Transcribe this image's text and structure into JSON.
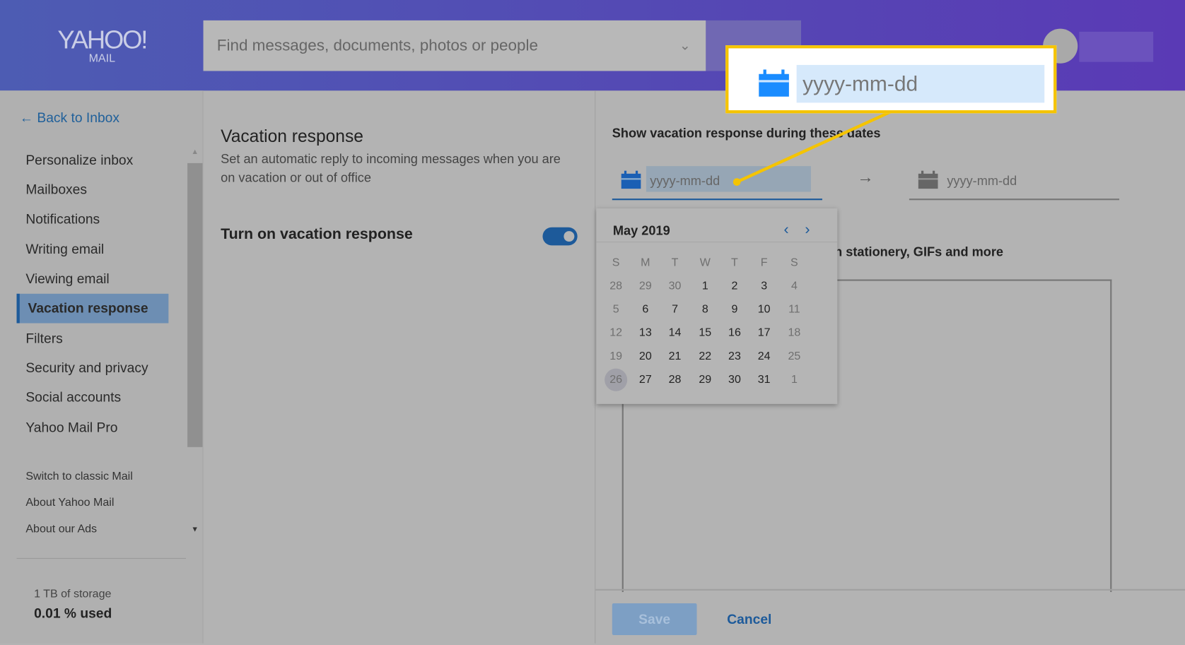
{
  "header": {
    "logo_main": "YAHOO!",
    "logo_sub": "MAIL",
    "search_placeholder": "Find messages, documents, photos or people"
  },
  "sidebar": {
    "back": "Back to Inbox",
    "items": [
      {
        "label": "Personalize inbox"
      },
      {
        "label": "Mailboxes"
      },
      {
        "label": "Notifications"
      },
      {
        "label": "Writing email"
      },
      {
        "label": "Viewing email"
      },
      {
        "label": "Vacation response",
        "selected": true
      },
      {
        "label": "Filters"
      },
      {
        "label": "Security and privacy"
      },
      {
        "label": "Social accounts"
      },
      {
        "label": "Yahoo Mail Pro"
      }
    ],
    "links": [
      {
        "label": "Switch to classic Mail"
      },
      {
        "label": "About Yahoo Mail"
      },
      {
        "label": "About our Ads"
      }
    ],
    "storage_label": "1 TB of storage",
    "storage_used": "0.01 % used"
  },
  "settings": {
    "title": "Vacation response",
    "description": "Set an automatic reply to incoming messages when you are on vacation or out of office",
    "toggle_label": "Turn on vacation response",
    "toggle_on": true
  },
  "dates": {
    "heading": "Show vacation response during these dates",
    "start_placeholder": "yyyy-mm-dd",
    "end_placeholder": "yyyy-mm-dd",
    "rich_text_label": "n stationery, GIFs and more"
  },
  "calendar": {
    "month": "May 2019",
    "weekdays": [
      "S",
      "M",
      "T",
      "W",
      "T",
      "F",
      "S"
    ],
    "weeks": [
      [
        "28",
        "29",
        "30",
        "1",
        "2",
        "3",
        "4"
      ],
      [
        "5",
        "6",
        "7",
        "8",
        "9",
        "10",
        "11"
      ],
      [
        "12",
        "13",
        "14",
        "15",
        "16",
        "17",
        "18"
      ],
      [
        "19",
        "20",
        "21",
        "22",
        "23",
        "24",
        "25"
      ],
      [
        "26",
        "27",
        "28",
        "29",
        "30",
        "31",
        "1"
      ]
    ],
    "today": "26"
  },
  "callout": {
    "placeholder": "yyyy-mm-dd"
  },
  "footer": {
    "save": "Save",
    "cancel": "Cancel"
  },
  "colors": {
    "accent": "#1d5a9a",
    "highlight": "#f5c400",
    "calendar_icon": "#1a73e8"
  }
}
